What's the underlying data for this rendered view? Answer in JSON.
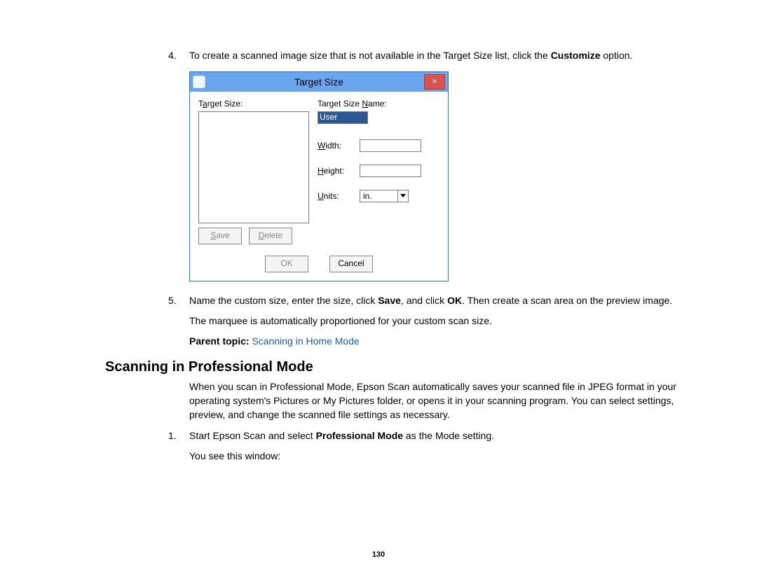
{
  "step4": {
    "number": "4.",
    "text_prefix": "To create a scanned image size that is not available in the Target Size list, click the ",
    "bold": "Customize",
    "text_suffix": " option."
  },
  "dialog": {
    "title": "Target Size",
    "close": "×",
    "left": {
      "label_pre": "T",
      "label_mid": "a",
      "label_post": "rget Size:",
      "save_btn": "Save",
      "delete_pre": "D",
      "delete_post": "elete"
    },
    "right": {
      "name_label_pre": "Target Size ",
      "name_label_u": "N",
      "name_label_post": "ame:",
      "name_value": "User Defined",
      "width_u": "W",
      "width_post": "idth:",
      "height_u": "H",
      "height_post": "eight:",
      "units_u": "U",
      "units_post": "nits:",
      "units_value": "in."
    },
    "footer": {
      "ok": "OK",
      "cancel": "Cancel"
    }
  },
  "step5": {
    "number": "5.",
    "p1a": "Name the custom size, enter the size, click ",
    "p1b": "Save",
    "p1c": ", and click ",
    "p1d": "OK",
    "p1e": ". Then create a scan area on the preview image.",
    "p2": "The marquee is automatically proportioned for your custom scan size."
  },
  "parent_topic": {
    "label": "Parent topic: ",
    "link": "Scanning in Home Mode"
  },
  "heading": "Scanning in Professional Mode",
  "intro": "When you scan in Professional Mode, Epson Scan automatically saves your scanned file in JPEG format in your operating system's Pictures or My Pictures folder, or opens it in your scanning program. You can select settings, preview, and change the scanned file settings as necessary.",
  "pm_step1": {
    "number": "1.",
    "t1": "Start Epson Scan and select ",
    "t2": "Professional Mode",
    "t3": " as the Mode setting.",
    "t4": "You see this window:"
  },
  "page_number": "130"
}
